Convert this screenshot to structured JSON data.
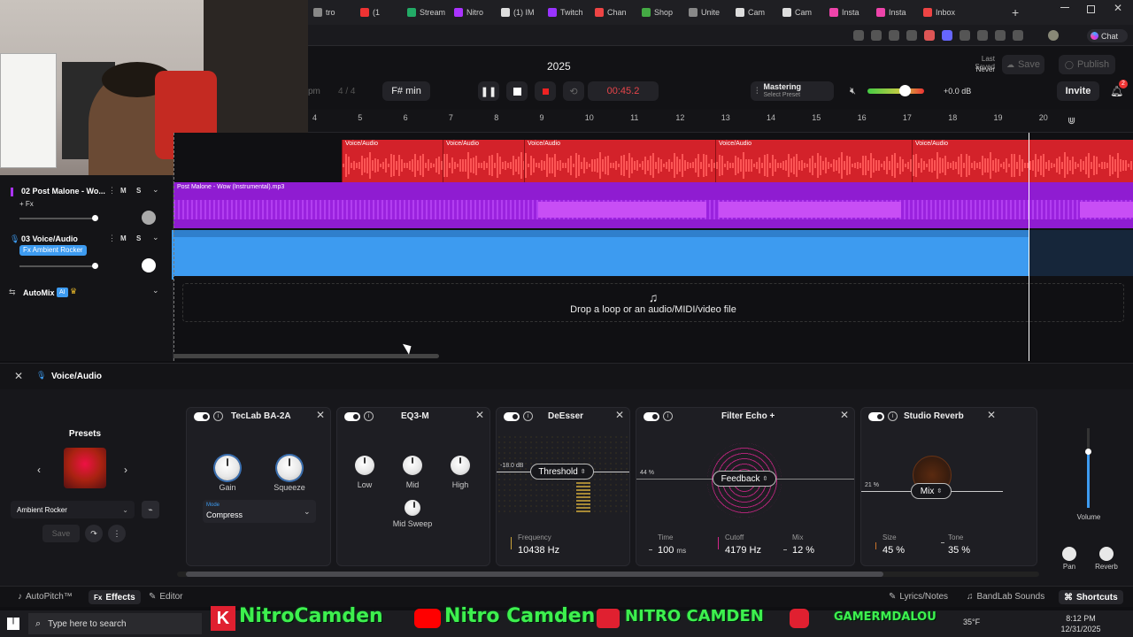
{
  "browser": {
    "tabs": [
      {
        "label": "tro",
        "color": "#888"
      },
      {
        "label": "(1",
        "color": "#e33"
      },
      {
        "label": "Stream",
        "color": "#2a6"
      },
      {
        "label": "Nitro",
        "color": "#a3f"
      },
      {
        "label": "(1) IM",
        "color": "#ddd"
      },
      {
        "label": "Twitch",
        "color": "#93f"
      },
      {
        "label": "Chan",
        "color": "#e44"
      },
      {
        "label": "Shop",
        "color": "#4a4"
      },
      {
        "label": "Unite",
        "color": "#888"
      },
      {
        "label": "Cam",
        "color": "#ddd"
      },
      {
        "label": "Cam",
        "color": "#ddd"
      },
      {
        "label": "Insta",
        "color": "#e4a"
      },
      {
        "label": "Insta",
        "color": "#e4a"
      },
      {
        "label": "Inbox",
        "color": "#e44"
      }
    ],
    "new_tab_label": "+",
    "chat_label": "Chat",
    "colors": {
      "accent": "#3d9bf0"
    }
  },
  "header": {
    "project_title": "2025",
    "bpm_partial": "pm",
    "time_signature": "4 / 4",
    "key": "F# min",
    "time_display": "00:45.2",
    "mastering_title": "Mastering",
    "mastering_sub": "Select Preset",
    "master_volume": "+0.0 dB",
    "last_saved_label": "Last Saved",
    "last_saved_value": "Never",
    "save_label": "Save",
    "publish_label": "Publish",
    "invite_label": "Invite",
    "notification_count": "2"
  },
  "ruler": {
    "ticks": [
      "4",
      "5",
      "6",
      "7",
      "8",
      "9",
      "10",
      "11",
      "12",
      "13",
      "14",
      "15",
      "16",
      "17",
      "18",
      "19",
      "20"
    ]
  },
  "tracks": [
    {
      "number": "02",
      "name": "Post Malone - Wo...",
      "fx": "+ Fx",
      "mute": "M",
      "solo": "S"
    },
    {
      "number": "03",
      "name": "Voice/Audio",
      "fx": "Fx Ambient Rocker",
      "mute": "M",
      "solo": "S"
    }
  ],
  "automix": {
    "label": "AutoMix",
    "badge": "AI"
  },
  "clips": {
    "voice_clip_labels": [
      "Voice/Audio",
      "Voice/Audio",
      "Voice/Audio",
      "Voice/Audio",
      "Voice/Audio"
    ],
    "purple_clip_label": "Post Malone - Wow (Instrumental).mp3",
    "drop_text": "Drop a loop or an audio/MIDI/video file"
  },
  "fx": {
    "track_name": "Voice/Audio",
    "presets_label": "Presets",
    "preset_name": "Ambient Rocker",
    "save_label": "Save",
    "plugins": {
      "teclab": {
        "name": "TecLab BA-2A",
        "gain": "Gain",
        "squeeze": "Squeeze",
        "mode_label": "Mode",
        "mode_value": "Compress"
      },
      "eq": {
        "name": "EQ3-M",
        "low": "Low",
        "mid": "Mid",
        "high": "High",
        "mid_sweep": "Mid Sweep"
      },
      "deesser": {
        "name": "DeEsser",
        "threshold": "Threshold",
        "db": "-18.0 dB",
        "freq_label": "Frequency",
        "freq_value": "10438 Hz"
      },
      "echo": {
        "name": "Filter Echo +",
        "feedback": "Feedback",
        "pct": "44 %",
        "time_label": "Time",
        "time_value": "100",
        "time_unit": "ms",
        "cutoff_label": "Cutoff",
        "cutoff_value": "4179 Hz",
        "mix_label": "Mix",
        "mix_value": "12 %"
      },
      "reverb": {
        "name": "Studio Reverb",
        "mix": "Mix",
        "pct": "21 %",
        "size_label": "Size",
        "size_value": "45 %",
        "tone_label": "Tone",
        "tone_value": "35 %"
      }
    },
    "volume_label": "Volume",
    "pan_label": "Pan",
    "reverb_label": "Reverb"
  },
  "bottom": {
    "autopitch": "AutoPitch™",
    "effects": "Effects",
    "editor": "Editor",
    "lyrics": "Lyrics/Notes",
    "bandlab_sounds": "BandLab Sounds",
    "shortcuts": "Shortcuts"
  },
  "overlay": {
    "name1": "NitroCamden",
    "name2": "Nitro Camden",
    "name3": "NITRO CAMDEN",
    "name4": "GAMERMDALOU"
  },
  "taskbar": {
    "search_placeholder": "Type here to search",
    "temperature": "35°F",
    "time": "8:12 PM",
    "date": "12/31/2025"
  }
}
